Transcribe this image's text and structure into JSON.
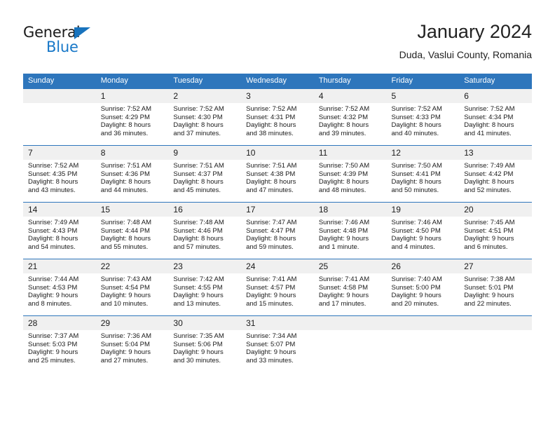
{
  "brand": {
    "name_top": "General",
    "name_bottom": "Blue",
    "accent_color": "#1878c8",
    "triangle_color": "#1873bd"
  },
  "header": {
    "title": "January 2024",
    "subtitle": "Duda, Vaslui County, Romania"
  },
  "theme": {
    "header_row_bg": "#2e76bc",
    "daynum_bg": "#f0f0f0",
    "cell_border": "#2e76bc",
    "text": "#1a1a1a"
  },
  "weekdays": [
    "Sunday",
    "Monday",
    "Tuesday",
    "Wednesday",
    "Thursday",
    "Friday",
    "Saturday"
  ],
  "labels": {
    "sunrise_prefix": "Sunrise:",
    "sunset_prefix": "Sunset:",
    "daylight_prefix": "Daylight:"
  },
  "weeks": [
    [
      {
        "day": "",
        "sunrise": "",
        "sunset": "",
        "daylight_1": "",
        "daylight_2": ""
      },
      {
        "day": "1",
        "sunrise": "Sunrise: 7:52 AM",
        "sunset": "Sunset: 4:29 PM",
        "daylight_1": "Daylight: 8 hours",
        "daylight_2": "and 36 minutes."
      },
      {
        "day": "2",
        "sunrise": "Sunrise: 7:52 AM",
        "sunset": "Sunset: 4:30 PM",
        "daylight_1": "Daylight: 8 hours",
        "daylight_2": "and 37 minutes."
      },
      {
        "day": "3",
        "sunrise": "Sunrise: 7:52 AM",
        "sunset": "Sunset: 4:31 PM",
        "daylight_1": "Daylight: 8 hours",
        "daylight_2": "and 38 minutes."
      },
      {
        "day": "4",
        "sunrise": "Sunrise: 7:52 AM",
        "sunset": "Sunset: 4:32 PM",
        "daylight_1": "Daylight: 8 hours",
        "daylight_2": "and 39 minutes."
      },
      {
        "day": "5",
        "sunrise": "Sunrise: 7:52 AM",
        "sunset": "Sunset: 4:33 PM",
        "daylight_1": "Daylight: 8 hours",
        "daylight_2": "and 40 minutes."
      },
      {
        "day": "6",
        "sunrise": "Sunrise: 7:52 AM",
        "sunset": "Sunset: 4:34 PM",
        "daylight_1": "Daylight: 8 hours",
        "daylight_2": "and 41 minutes."
      }
    ],
    [
      {
        "day": "7",
        "sunrise": "Sunrise: 7:52 AM",
        "sunset": "Sunset: 4:35 PM",
        "daylight_1": "Daylight: 8 hours",
        "daylight_2": "and 43 minutes."
      },
      {
        "day": "8",
        "sunrise": "Sunrise: 7:51 AM",
        "sunset": "Sunset: 4:36 PM",
        "daylight_1": "Daylight: 8 hours",
        "daylight_2": "and 44 minutes."
      },
      {
        "day": "9",
        "sunrise": "Sunrise: 7:51 AM",
        "sunset": "Sunset: 4:37 PM",
        "daylight_1": "Daylight: 8 hours",
        "daylight_2": "and 45 minutes."
      },
      {
        "day": "10",
        "sunrise": "Sunrise: 7:51 AM",
        "sunset": "Sunset: 4:38 PM",
        "daylight_1": "Daylight: 8 hours",
        "daylight_2": "and 47 minutes."
      },
      {
        "day": "11",
        "sunrise": "Sunrise: 7:50 AM",
        "sunset": "Sunset: 4:39 PM",
        "daylight_1": "Daylight: 8 hours",
        "daylight_2": "and 48 minutes."
      },
      {
        "day": "12",
        "sunrise": "Sunrise: 7:50 AM",
        "sunset": "Sunset: 4:41 PM",
        "daylight_1": "Daylight: 8 hours",
        "daylight_2": "and 50 minutes."
      },
      {
        "day": "13",
        "sunrise": "Sunrise: 7:49 AM",
        "sunset": "Sunset: 4:42 PM",
        "daylight_1": "Daylight: 8 hours",
        "daylight_2": "and 52 minutes."
      }
    ],
    [
      {
        "day": "14",
        "sunrise": "Sunrise: 7:49 AM",
        "sunset": "Sunset: 4:43 PM",
        "daylight_1": "Daylight: 8 hours",
        "daylight_2": "and 54 minutes."
      },
      {
        "day": "15",
        "sunrise": "Sunrise: 7:48 AM",
        "sunset": "Sunset: 4:44 PM",
        "daylight_1": "Daylight: 8 hours",
        "daylight_2": "and 55 minutes."
      },
      {
        "day": "16",
        "sunrise": "Sunrise: 7:48 AM",
        "sunset": "Sunset: 4:46 PM",
        "daylight_1": "Daylight: 8 hours",
        "daylight_2": "and 57 minutes."
      },
      {
        "day": "17",
        "sunrise": "Sunrise: 7:47 AM",
        "sunset": "Sunset: 4:47 PM",
        "daylight_1": "Daylight: 8 hours",
        "daylight_2": "and 59 minutes."
      },
      {
        "day": "18",
        "sunrise": "Sunrise: 7:46 AM",
        "sunset": "Sunset: 4:48 PM",
        "daylight_1": "Daylight: 9 hours",
        "daylight_2": "and 1 minute."
      },
      {
        "day": "19",
        "sunrise": "Sunrise: 7:46 AM",
        "sunset": "Sunset: 4:50 PM",
        "daylight_1": "Daylight: 9 hours",
        "daylight_2": "and 4 minutes."
      },
      {
        "day": "20",
        "sunrise": "Sunrise: 7:45 AM",
        "sunset": "Sunset: 4:51 PM",
        "daylight_1": "Daylight: 9 hours",
        "daylight_2": "and 6 minutes."
      }
    ],
    [
      {
        "day": "21",
        "sunrise": "Sunrise: 7:44 AM",
        "sunset": "Sunset: 4:53 PM",
        "daylight_1": "Daylight: 9 hours",
        "daylight_2": "and 8 minutes."
      },
      {
        "day": "22",
        "sunrise": "Sunrise: 7:43 AM",
        "sunset": "Sunset: 4:54 PM",
        "daylight_1": "Daylight: 9 hours",
        "daylight_2": "and 10 minutes."
      },
      {
        "day": "23",
        "sunrise": "Sunrise: 7:42 AM",
        "sunset": "Sunset: 4:55 PM",
        "daylight_1": "Daylight: 9 hours",
        "daylight_2": "and 13 minutes."
      },
      {
        "day": "24",
        "sunrise": "Sunrise: 7:41 AM",
        "sunset": "Sunset: 4:57 PM",
        "daylight_1": "Daylight: 9 hours",
        "daylight_2": "and 15 minutes."
      },
      {
        "day": "25",
        "sunrise": "Sunrise: 7:41 AM",
        "sunset": "Sunset: 4:58 PM",
        "daylight_1": "Daylight: 9 hours",
        "daylight_2": "and 17 minutes."
      },
      {
        "day": "26",
        "sunrise": "Sunrise: 7:40 AM",
        "sunset": "Sunset: 5:00 PM",
        "daylight_1": "Daylight: 9 hours",
        "daylight_2": "and 20 minutes."
      },
      {
        "day": "27",
        "sunrise": "Sunrise: 7:38 AM",
        "sunset": "Sunset: 5:01 PM",
        "daylight_1": "Daylight: 9 hours",
        "daylight_2": "and 22 minutes."
      }
    ],
    [
      {
        "day": "28",
        "sunrise": "Sunrise: 7:37 AM",
        "sunset": "Sunset: 5:03 PM",
        "daylight_1": "Daylight: 9 hours",
        "daylight_2": "and 25 minutes."
      },
      {
        "day": "29",
        "sunrise": "Sunrise: 7:36 AM",
        "sunset": "Sunset: 5:04 PM",
        "daylight_1": "Daylight: 9 hours",
        "daylight_2": "and 27 minutes."
      },
      {
        "day": "30",
        "sunrise": "Sunrise: 7:35 AM",
        "sunset": "Sunset: 5:06 PM",
        "daylight_1": "Daylight: 9 hours",
        "daylight_2": "and 30 minutes."
      },
      {
        "day": "31",
        "sunrise": "Sunrise: 7:34 AM",
        "sunset": "Sunset: 5:07 PM",
        "daylight_1": "Daylight: 9 hours",
        "daylight_2": "and 33 minutes."
      },
      {
        "day": "",
        "sunrise": "",
        "sunset": "",
        "daylight_1": "",
        "daylight_2": ""
      },
      {
        "day": "",
        "sunrise": "",
        "sunset": "",
        "daylight_1": "",
        "daylight_2": ""
      },
      {
        "day": "",
        "sunrise": "",
        "sunset": "",
        "daylight_1": "",
        "daylight_2": ""
      }
    ]
  ]
}
